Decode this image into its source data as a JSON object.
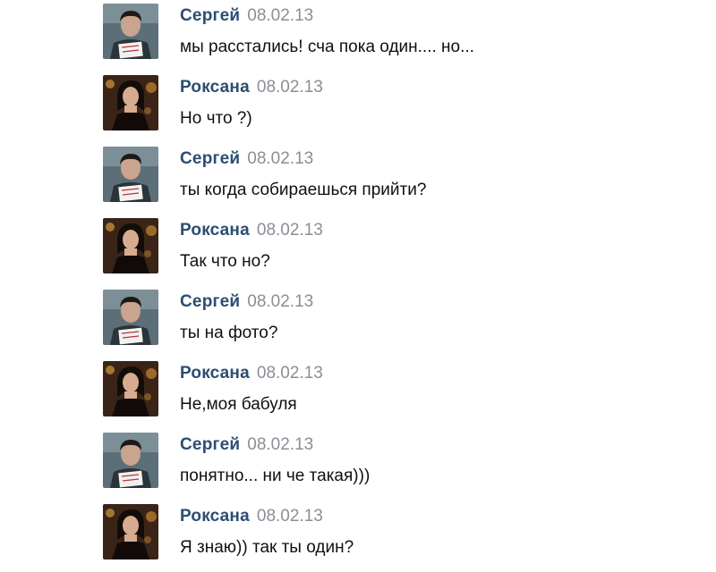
{
  "messages": [
    {
      "author": "Сергей",
      "date": "08.02.13",
      "text": "мы расстались! сча пока один.... но...",
      "avatar": "sergey-avatar"
    },
    {
      "author": "Роксана",
      "date": "08.02.13",
      "text": "Но что ?)",
      "avatar": "roksana-avatar"
    },
    {
      "author": "Сергей",
      "date": "08.02.13",
      "text": "ты когда собираешься прийти?",
      "avatar": "sergey-avatar"
    },
    {
      "author": "Роксана",
      "date": "08.02.13",
      "text": "Так что но?",
      "avatar": "roksana-avatar"
    },
    {
      "author": "Сергей",
      "date": "08.02.13",
      "text": "ты на фото?",
      "avatar": "sergey-avatar"
    },
    {
      "author": "Роксана",
      "date": "08.02.13",
      "text": "Не,моя бабуля",
      "avatar": "roksana-avatar"
    },
    {
      "author": "Сергей",
      "date": "08.02.13",
      "text": "понятно... ни че такая)))",
      "avatar": "sergey-avatar"
    },
    {
      "author": "Роксана",
      "date": "08.02.13",
      "text": "Я знаю)) так ты один?",
      "avatar": "roksana-avatar"
    }
  ],
  "colors": {
    "author_name": "#2c4d73",
    "date": "#8a8f96",
    "message_text": "#101010",
    "background": "#ffffff"
  }
}
